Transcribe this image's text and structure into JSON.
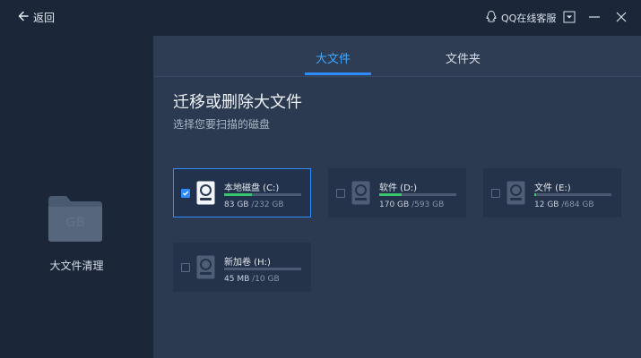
{
  "titlebar": {
    "back_label": "返回",
    "qq_label": "QQ在线客服"
  },
  "sidebar": {
    "folder_text": "GB",
    "label": "大文件清理"
  },
  "tabs": [
    {
      "label": "大文件",
      "active": true
    },
    {
      "label": "文件夹",
      "active": false
    }
  ],
  "main": {
    "title": "迁移或删除大文件",
    "subtitle": "选择您要扫描的磁盘"
  },
  "drives": [
    {
      "name": "本地磁盘 (C:)",
      "used": "83 GB",
      "total": "/232 GB",
      "fraction": 0.36,
      "checked": true
    },
    {
      "name": "软件 (D:)",
      "used": "170 GB",
      "total": "/593 GB",
      "fraction": 0.29,
      "checked": false
    },
    {
      "name": "文件 (E:)",
      "used": "12 GB",
      "total": "/684 GB",
      "fraction": 0.02,
      "checked": false
    },
    {
      "name": "新加卷 (H:)",
      "used": "45 MB",
      "total": "/10 GB",
      "fraction": 0.0,
      "checked": false
    }
  ],
  "colors": {
    "accent": "#2f8cff",
    "bar_fill": "#39c46e"
  }
}
